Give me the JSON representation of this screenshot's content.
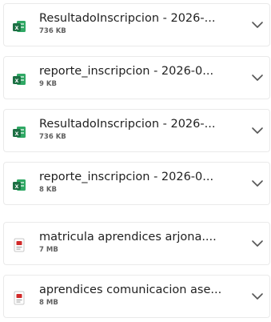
{
  "downloads": [
    {
      "name": "ResultadoInscripcion - 2026-...",
      "size": "736 KB",
      "icon": "excel-file-icon"
    },
    {
      "name": "reporte_inscripcion - 2026-0...",
      "size": "9 KB",
      "icon": "excel-file-icon"
    },
    {
      "name": "ResultadoInscripcion - 2026-...",
      "size": "736 KB",
      "icon": "excel-file-icon"
    },
    {
      "name": "reporte_inscripcion - 2026-0...",
      "size": "8 KB",
      "icon": "excel-file-icon"
    },
    {
      "name": "matricula aprendices arjona....",
      "size": "7 MB",
      "icon": "pdf-file-icon"
    },
    {
      "name": "aprendices comunicacion ase...",
      "size": "8 MB",
      "icon": "pdf-file-icon"
    }
  ],
  "colors": {
    "excel_green": "#1d7044",
    "pdf_red": "#d12a2a"
  }
}
